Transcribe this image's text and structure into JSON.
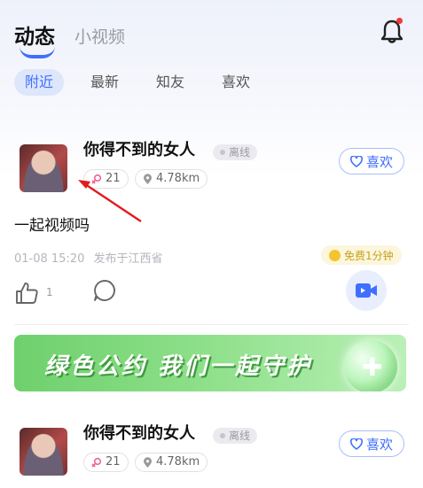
{
  "header": {
    "tab_active": "动态",
    "tab_inactive": "小视频",
    "bell_icon": "bell-icon",
    "accent_color": "#3f6fff",
    "badge_color": "#f03a3a"
  },
  "filters": [
    {
      "label": "附近",
      "active": true
    },
    {
      "label": "最新",
      "active": false
    },
    {
      "label": "知友",
      "active": false
    },
    {
      "label": "喜欢",
      "active": false
    }
  ],
  "posts": [
    {
      "username": "你得不到的女人",
      "status": "离线",
      "female_count": "21",
      "distance": "4.78km",
      "like_label": "喜欢",
      "text": "一起视频吗",
      "time": "01-08 15:20",
      "location": "发布于江西省",
      "free_badge": "免费1分钟",
      "like_count": "1"
    },
    {
      "username": "你得不到的女人",
      "status": "离线",
      "female_count": "21",
      "distance": "4.78km",
      "like_label": "喜欢"
    }
  ],
  "banner": {
    "text": "绿色公约 我们一起守护",
    "color": "#6ed06c"
  }
}
